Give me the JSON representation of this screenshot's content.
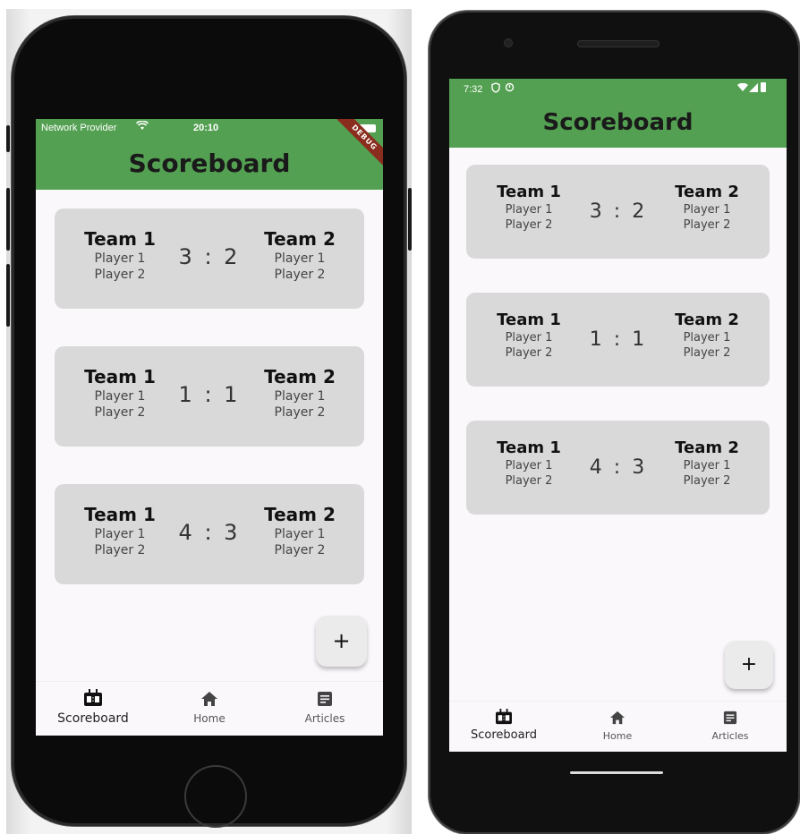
{
  "app": {
    "title": "Scoreboard",
    "accent_color": "#54a052",
    "debug_banner": "DEBUG"
  },
  "ios_status": {
    "carrier": "Network Provider",
    "time": "20:10"
  },
  "android_status": {
    "time": "7:32"
  },
  "matches": [
    {
      "team1": {
        "name": "Team 1",
        "players": [
          "Player 1",
          "Player 2"
        ]
      },
      "team2": {
        "name": "Team 2",
        "players": [
          "Player 1",
          "Player 2"
        ]
      },
      "score": "3 : 2"
    },
    {
      "team1": {
        "name": "Team 1",
        "players": [
          "Player 1",
          "Player 2"
        ]
      },
      "team2": {
        "name": "Team 2",
        "players": [
          "Player 1",
          "Player 2"
        ]
      },
      "score": "1 : 1"
    },
    {
      "team1": {
        "name": "Team 1",
        "players": [
          "Player 1",
          "Player 2"
        ]
      },
      "team2": {
        "name": "Team 2",
        "players": [
          "Player 1",
          "Player 2"
        ]
      },
      "score": "4 : 3"
    }
  ],
  "fab": {
    "label": "+",
    "icon": "add-icon"
  },
  "nav": [
    {
      "label": "Scoreboard",
      "icon": "scoreboard-icon",
      "selected": true
    },
    {
      "label": "Home",
      "icon": "home-icon",
      "selected": false
    },
    {
      "label": "Articles",
      "icon": "article-icon",
      "selected": false
    }
  ]
}
